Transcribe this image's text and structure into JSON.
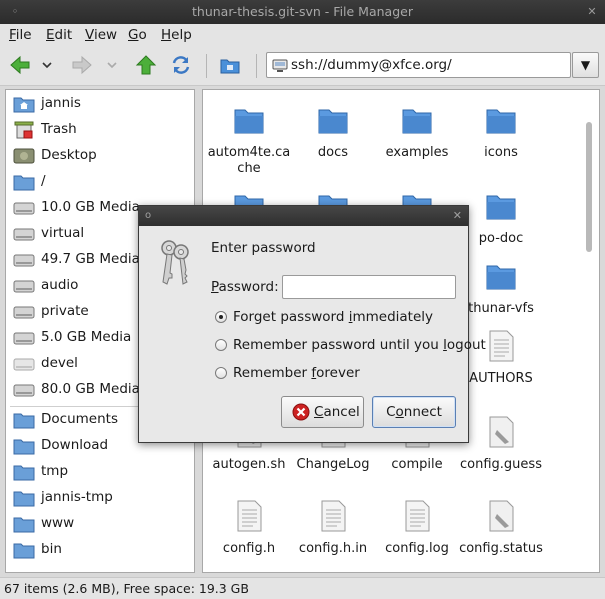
{
  "window": {
    "title": "thunar-thesis.git-svn - File Manager"
  },
  "menu": [
    {
      "label": "File",
      "mnemonic": "F",
      "rest": "ile"
    },
    {
      "label": "Edit",
      "mnemonic": "E",
      "rest": "dit"
    },
    {
      "label": "View",
      "mnemonic": "V",
      "rest": "iew"
    },
    {
      "label": "Go",
      "mnemonic": "G",
      "rest": "o"
    },
    {
      "label": "Help",
      "mnemonic": "H",
      "rest": "elp"
    }
  ],
  "location": {
    "value": "ssh://dummy@xfce.org/"
  },
  "sidebar": {
    "devices": [
      {
        "label": "jannis",
        "icon": "home-folder-icon"
      },
      {
        "label": "Trash",
        "icon": "trash-icon"
      },
      {
        "label": "Desktop",
        "icon": "desktop-icon"
      },
      {
        "label": "/",
        "icon": "folder-icon"
      },
      {
        "label": "10.0 GB Media",
        "icon": "drive-icon"
      },
      {
        "label": "virtual",
        "icon": "drive-icon"
      },
      {
        "label": "49.7 GB Media",
        "icon": "drive-icon"
      },
      {
        "label": "audio",
        "icon": "drive-icon"
      },
      {
        "label": "private",
        "icon": "drive-icon"
      },
      {
        "label": "5.0 GB Media",
        "icon": "drive-icon"
      },
      {
        "label": "devel",
        "icon": "drive-icon"
      },
      {
        "label": "80.0 GB Media",
        "icon": "drive-icon"
      }
    ],
    "places": [
      {
        "label": "Documents",
        "icon": "folder-icon"
      },
      {
        "label": "Download",
        "icon": "folder-icon"
      },
      {
        "label": "tmp",
        "icon": "folder-icon"
      },
      {
        "label": "jannis-tmp",
        "icon": "folder-icon"
      },
      {
        "label": "www",
        "icon": "folder-icon"
      },
      {
        "label": "bin",
        "icon": "folder-icon"
      }
    ]
  },
  "files": [
    {
      "name": "autom4te.cache",
      "type": "folder"
    },
    {
      "name": "docs",
      "type": "folder"
    },
    {
      "name": "examples",
      "type": "folder"
    },
    {
      "name": "icons",
      "type": "folder"
    },
    {
      "name": "po-doc",
      "type": "folder"
    },
    {
      "name": "thunar-vfs",
      "type": "folder"
    },
    {
      "name": "AUTHORS",
      "type": "text"
    },
    {
      "name": "autogen.sh",
      "type": "script"
    },
    {
      "name": "ChangeLog",
      "type": "text"
    },
    {
      "name": "compile",
      "type": "script"
    },
    {
      "name": "config.guess",
      "type": "script"
    },
    {
      "name": "config.h",
      "type": "text"
    },
    {
      "name": "config.h.in",
      "type": "text"
    },
    {
      "name": "config.log",
      "type": "text"
    },
    {
      "name": "config.status",
      "type": "script"
    }
  ],
  "statusbar": {
    "text": "67 items (2.6 MB), Free space: 19.3 GB"
  },
  "dialog": {
    "heading": "Enter password",
    "password_label_mn": "P",
    "password_label_rest": "assword:",
    "password_value": "",
    "options": [
      {
        "pre": "Forget password ",
        "mn": "i",
        "post": "mmediately",
        "selected": true
      },
      {
        "pre": "Remember password until you ",
        "mn": "l",
        "post": "ogout",
        "selected": false
      },
      {
        "pre": "Remember ",
        "mn": "f",
        "post": "orever",
        "selected": false
      }
    ],
    "cancel_mn": "C",
    "cancel_rest": "ancel",
    "connect_mn": "o",
    "connect_pre": "C",
    "connect_rest": "nnect"
  },
  "colors": {
    "folder": "#4a90d9",
    "accent": "#5a7fb3",
    "cancel": "#cc2222"
  }
}
